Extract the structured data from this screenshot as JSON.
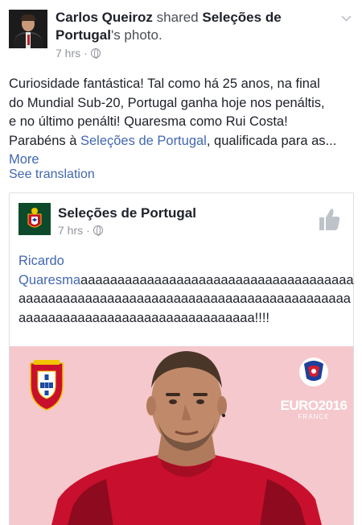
{
  "post": {
    "author": "Carlos Queiroz",
    "action": "shared",
    "page_name": "Seleções de Portugal",
    "suffix": "'s photo.",
    "time": "7 hrs",
    "text_line1": "Curiosidade fantástica! Tal como há 25 anos, na final",
    "text_line2": "do Mundial Sub-20, Portugal ganha hoje nos penáltis,",
    "text_line3": "e no último penálti! Quaresma como Rui Costa!",
    "text_line4_prefix": "Parabéns à ",
    "text_line4_link": "Seleções de Portugal",
    "text_line4_suffix": ", qualificada para as...",
    "more_label": "More",
    "see_translation": "See translation"
  },
  "shared": {
    "page_name": "Seleções de Portugal",
    "time": "7 hrs",
    "mention_first": "Ricardo",
    "mention_last": "Quaresma",
    "text_after_mention": "aaaaaaaaaaaaaaaaaaaaaaaaaaaaaaaaaaaaaaaaaaaaaaaaaaaaaaaaaaaaaaaaaaaaaaaaaaaaaaaaaaaaaaaaaaaaaaaaaaaaaaaaaaaaaaaaaa!!!!",
    "photo": {
      "logo_text": "EURO2016",
      "logo_sub": "FRANCE"
    }
  },
  "icons": {
    "chevron": "chevron-down-icon",
    "globe": "globe-icon",
    "like": "thumbs-up-icon"
  },
  "colors": {
    "link": "#4267b2",
    "meta": "#90949c",
    "photo_bg": "#f4c8cc",
    "jersey": "#c8102e"
  }
}
